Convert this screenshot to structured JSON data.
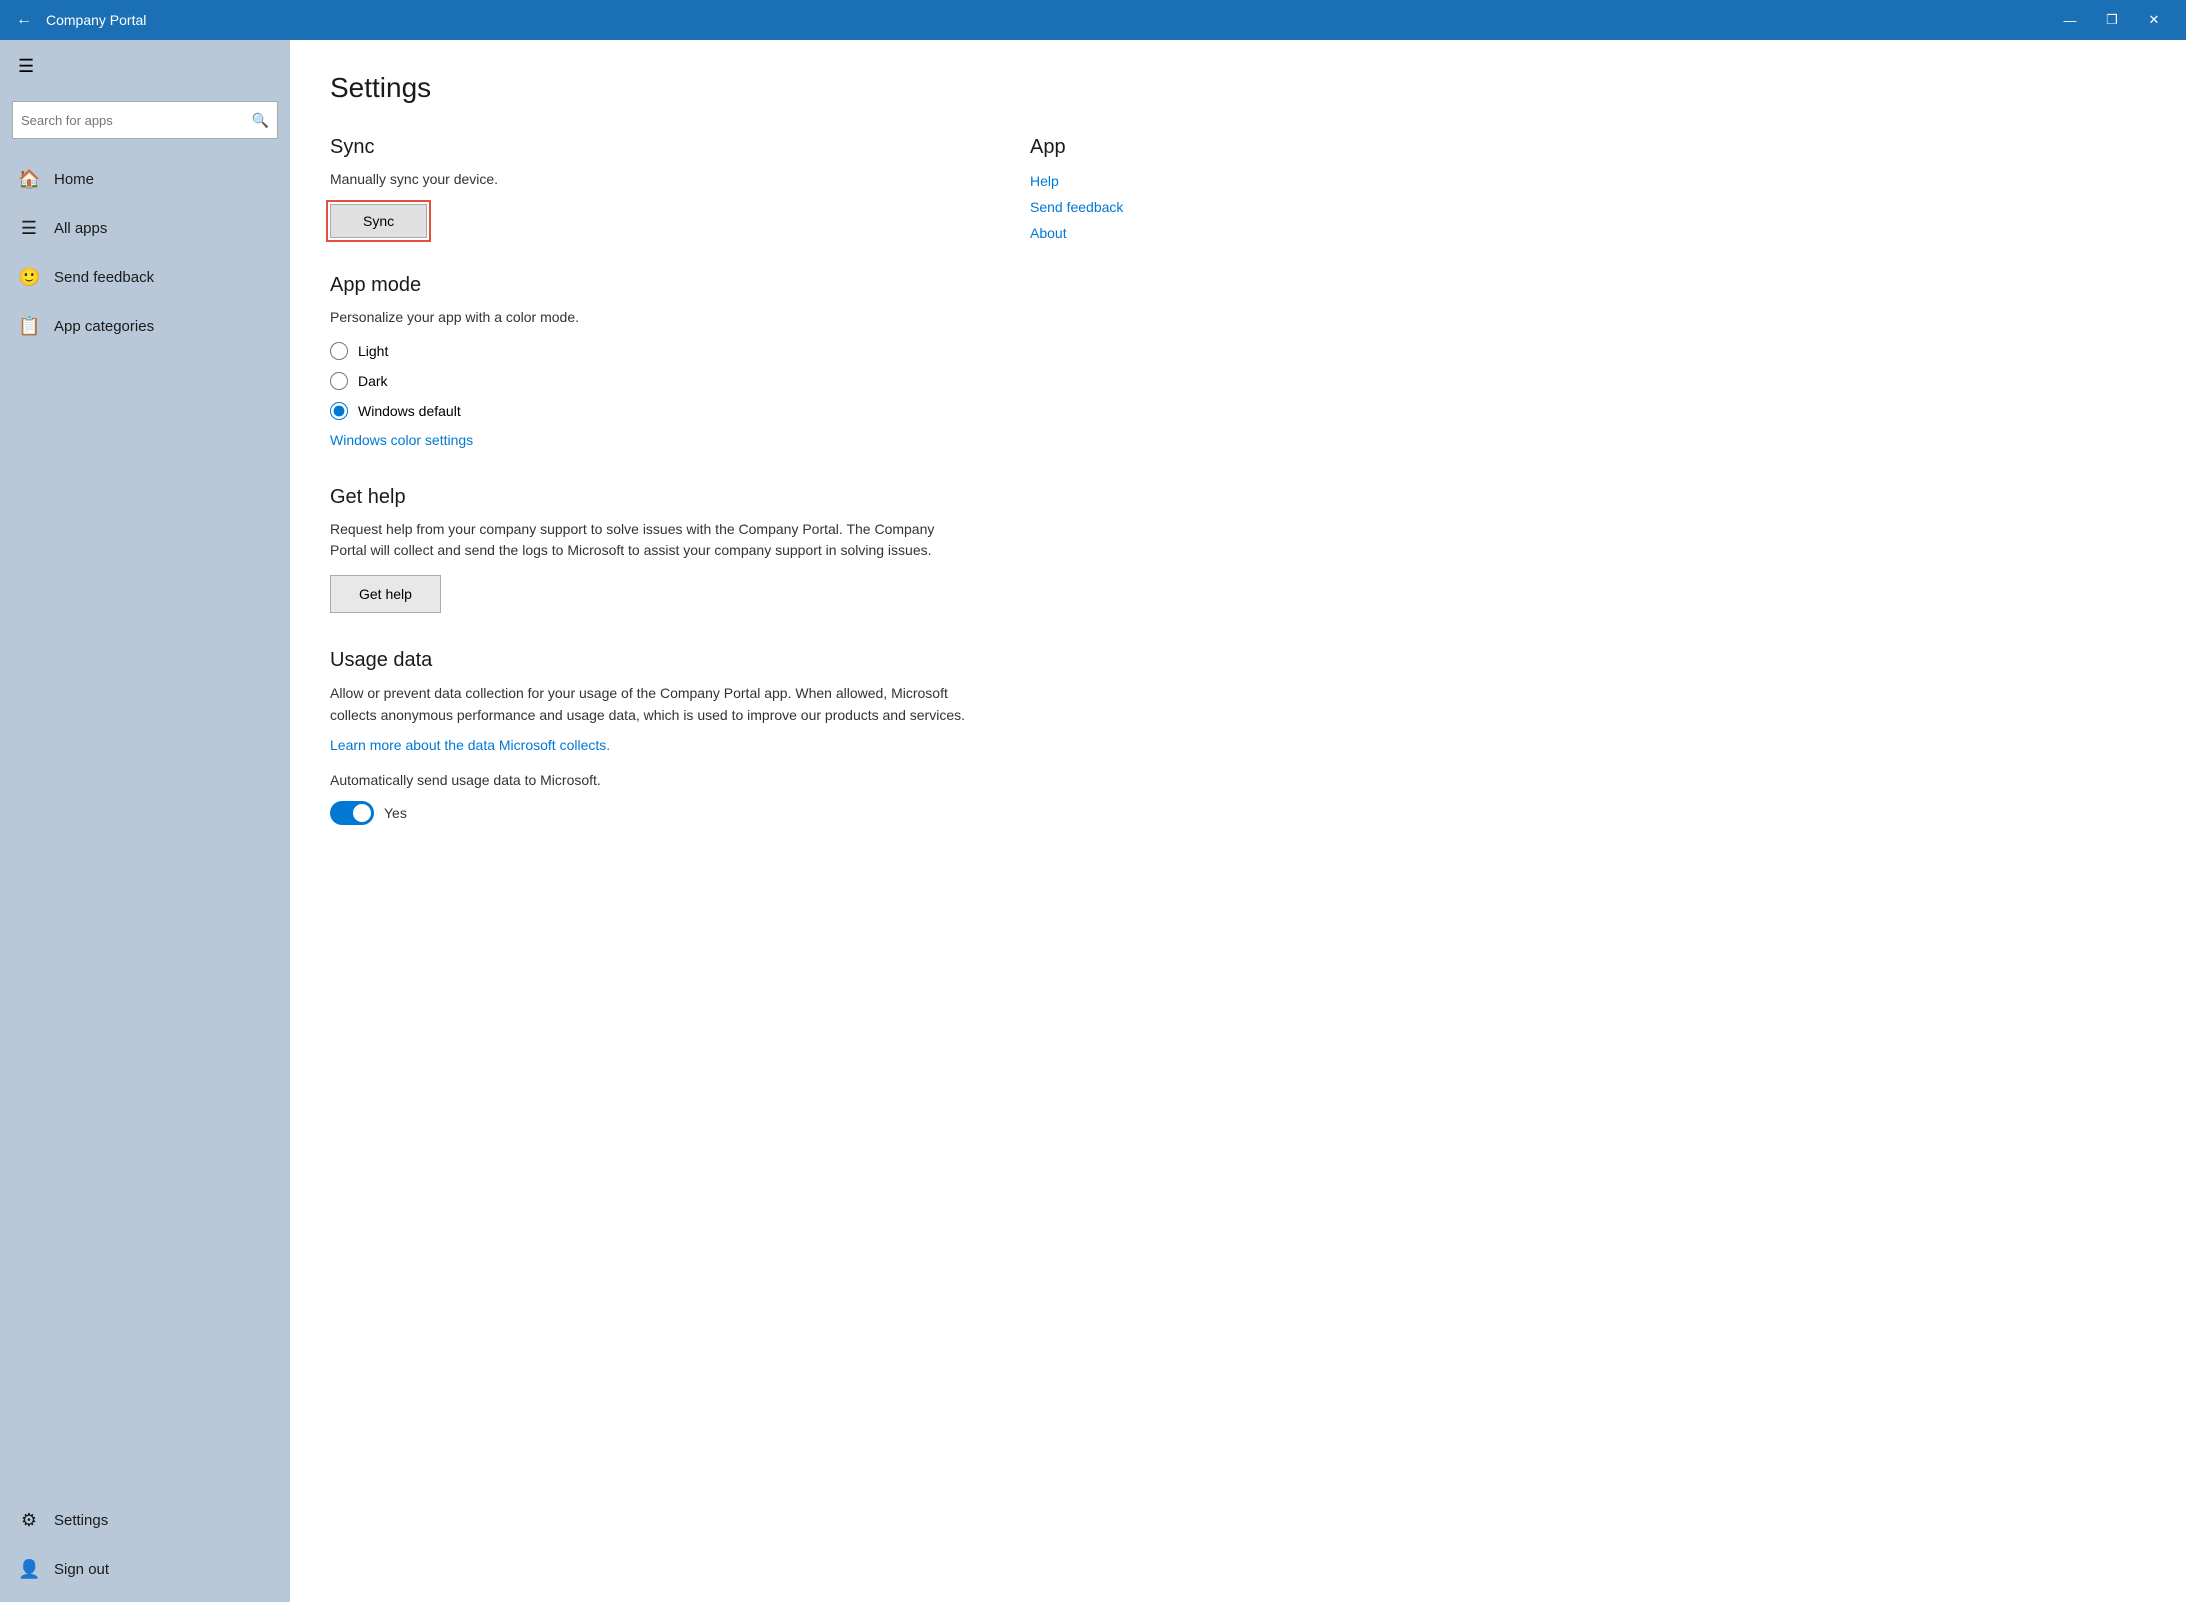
{
  "titleBar": {
    "title": "Company Portal",
    "backLabel": "←",
    "minimizeLabel": "—",
    "maximizeLabel": "❐",
    "closeLabel": "✕"
  },
  "sidebar": {
    "hamburgerIcon": "☰",
    "searchPlaceholder": "Search for apps",
    "searchIcon": "⌕",
    "navItems": [
      {
        "id": "home",
        "icon": "⌂",
        "label": "Home"
      },
      {
        "id": "all-apps",
        "icon": "≡",
        "label": "All apps"
      },
      {
        "id": "send-feedback",
        "icon": "☺",
        "label": "Send feedback"
      },
      {
        "id": "app-categories",
        "icon": "≣",
        "label": "App categories"
      }
    ],
    "bottomItems": [
      {
        "id": "settings",
        "icon": "⚙",
        "label": "Settings"
      },
      {
        "id": "sign-out",
        "icon": "👤",
        "label": "Sign out"
      }
    ]
  },
  "main": {
    "pageTitle": "Settings",
    "sections": {
      "sync": {
        "title": "Sync",
        "description": "Manually sync your device.",
        "buttonLabel": "Sync"
      },
      "appMode": {
        "title": "App mode",
        "description": "Personalize your app with a color mode.",
        "options": [
          {
            "id": "light",
            "label": "Light",
            "checked": false
          },
          {
            "id": "dark",
            "label": "Dark",
            "checked": false
          },
          {
            "id": "windows-default",
            "label": "Windows default",
            "checked": true
          }
        ],
        "colorSettingsLink": "Windows color settings"
      },
      "getHelp": {
        "title": "Get help",
        "description": "Request help from your company support to solve issues with the Company Portal. The Company Portal will collect and send the logs to Microsoft to assist your company support in solving issues.",
        "buttonLabel": "Get help"
      },
      "usageData": {
        "title": "Usage data",
        "description": "Allow or prevent data collection for your usage of the Company Portal app. When allowed, Microsoft collects anonymous performance and usage data, which is used to improve our products and services.",
        "learnMoreLink": "Learn more about the data Microsoft collects.",
        "autoSendLabel": "Automatically send usage data to Microsoft.",
        "toggleLabel": "Yes"
      }
    }
  },
  "sideColumn": {
    "appSectionTitle": "App",
    "links": [
      {
        "id": "help",
        "label": "Help"
      },
      {
        "id": "send-feedback",
        "label": "Send feedback"
      },
      {
        "id": "about",
        "label": "About"
      }
    ]
  }
}
